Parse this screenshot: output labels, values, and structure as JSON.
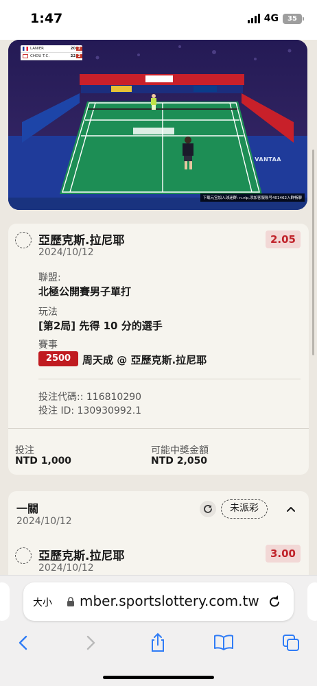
{
  "status_bar": {
    "time": "1:47",
    "network": "4G",
    "battery": "35"
  },
  "video": {
    "scoreboard": [
      {
        "name": "LANIER",
        "flag": "fr",
        "set": "20",
        "game": "2"
      },
      {
        "name": "CHOU T.C.",
        "flag": "tw",
        "set": "22",
        "game": "2"
      }
    ],
    "caption": "下载元宝加入球迷群: n.vip,添加客服账号401462入群畅聊",
    "banner_text": "VANTAA"
  },
  "bet_card": {
    "selection": "亞歷克斯.拉尼耶",
    "date": "2024/10/12",
    "odds": "2.05",
    "league_label": "聯盟:",
    "league_value": "北極公開賽男子單打",
    "market_label": "玩法",
    "market_value": "[第2局] 先得 10 分的選手",
    "event_label": "賽事",
    "event_code": "2500",
    "event_value": "周天成 @ 亞歷克斯.拉尼耶",
    "bet_code": "投注代碼:: 116810290",
    "bet_id": "投注 ID: 130930992.1",
    "stake_label": "投注",
    "stake_value": "NTD 1,000",
    "payout_label": "可能中獎金額",
    "payout_value": "NTD 2,050"
  },
  "parlay_card": {
    "title": "一關",
    "date": "2024/10/12",
    "status": "未派彩",
    "selection": "亞歷克斯.拉尼耶",
    "selection_date": "2024/10/12",
    "odds": "3.00"
  },
  "browser": {
    "text_size": "大小",
    "url": "mber.sportslottery.com.tw"
  },
  "colors": {
    "odds_text": "#c0232a",
    "odds_bg": "#f2d8d6",
    "tag_bg": "#c01b20",
    "accent_blue": "#2f7cf6"
  }
}
